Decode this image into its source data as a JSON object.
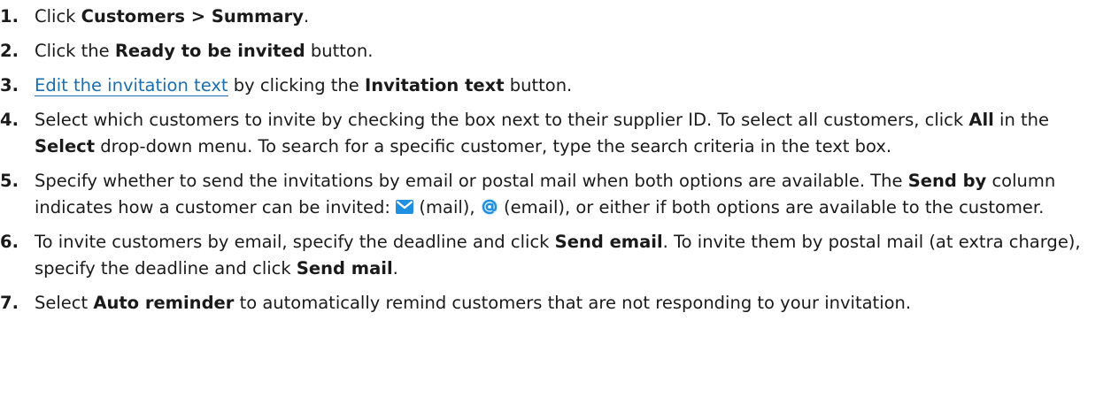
{
  "steps": [
    {
      "num": "1.",
      "parts": [
        "Click ",
        "Customers > Summary",
        "."
      ]
    },
    {
      "num": "2.",
      "parts": [
        "Click the ",
        "Ready to be invited",
        " button."
      ]
    },
    {
      "num": "3.",
      "link": "Edit the invitation text",
      "parts": [
        " by clicking the ",
        "Invitation text",
        " button."
      ]
    },
    {
      "num": "4.",
      "parts": [
        "Select which customers to invite by checking the box next to their supplier ID. To select all customers, click ",
        "All",
        " in the ",
        "Select",
        " drop-down menu. To search for a specific customer, type the search criteria in the text box."
      ]
    },
    {
      "num": "5.",
      "parts": [
        "Specify whether to send the invitations by email or postal mail when both options are available. The ",
        "Send by",
        " column indicates how a customer can be invited: ",
        " (mail), ",
        " (email), or either if both options are available to the customer."
      ]
    },
    {
      "num": "6.",
      "parts": [
        "To invite customers by email, specify the deadline and click ",
        "Send email",
        ". To invite them by postal mail (at extra charge), specify the deadline and click ",
        "Send mail",
        "."
      ]
    },
    {
      "num": "7.",
      "parts": [
        "Select ",
        "Auto reminder",
        " to automatically remind customers that are not responding to your invitation."
      ]
    }
  ],
  "icons": {
    "mail": "envelope-icon",
    "email": "at-sign-icon"
  },
  "colors": {
    "link": "#1a6fb3",
    "icon_blue": "#1f8fe0"
  }
}
